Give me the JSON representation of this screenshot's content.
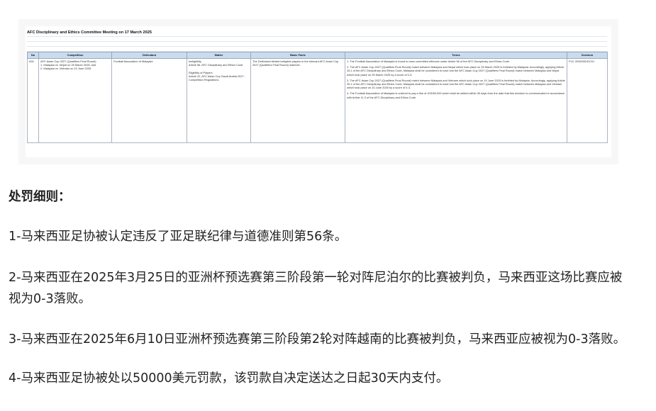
{
  "sheet": {
    "title": "AFC Disciplinary and Ethics Committee Meeting on 17 March 2025",
    "headers": [
      "No",
      "Competition",
      "Defendant",
      "Matter",
      "Basic Facts",
      "Terms",
      "Decision"
    ],
    "row": {
      "no": "A01",
      "competition": "AFC Asian Cup 2027 (Qualifiers Final Round)\n1. Malaysia vs. Nepal on 25 March 2025; and\n2. Malaysia vs. Vietnam on 10 June 2025.",
      "defendant": "Football Association of Malaysia",
      "matter": "Ineligibility\nArticle 56, AFC Disciplinary and Ethics Code\n\nEligibility of Players\nArticle 22, AFC Asian Cup Saudi Arabia 2027 - Competition Regulations",
      "basic_facts": "The Defendant fielded ineligible players in the relevant AFC Asian Cup 2027 (Qualifiers Final Round) matches.",
      "terms": [
        "1. The Football Association of Malaysia is found to have committed offences under Article 56 of the AFC Disciplinary and Ethics Code.",
        "2. The AFC Asian Cup 2027 (Qualifiers Final Round) match between Malaysia and Nepal which took place on 25 March 2025 is forfeited by Malaysia. Accordingly, applying Article 25.1 of the AFC Disciplinary and Ethics Code, Malaysia shall be considered to have lost the AFC Asian Cup 2027 (Qualifiers Final Round) match between Malaysia and Nepal which took place on 25 March 2025 by a score of 0-3.",
        "3. The AFC Asian Cup 2027 (Qualifiers Final Round) match between Malaysia and Vietnam which took place on 10 June 2025 is forfeited by Malaysia. Accordingly, applying Article 25.1 of the AFC Disciplinary and Ethics Code, Malaysia shall be considered to have lost the AFC Asian Cup 2027 (Qualifiers Final Round) match between Malaysia and Vietnam which took place on 10 June 2025 by a score of 0-3.",
        "4. The Football Association of Malaysia is ordered to pay a fine of USD50,000 which shall be settled within 30 days from the date that this decision is communicated in accordance with Article 11.3 of the AFC Disciplinary and Ethics Code."
      ],
      "decision": "FVC 2025/051/DC01"
    }
  },
  "article": {
    "heading": "处罚细则：",
    "items": [
      "1-马来西亚足协被认定违反了亚足联纪律与道德准则第56条。",
      "2-马来西亚在2025年3月25日的亚洲杯预选赛第三阶段第一轮对阵尼泊尔的比赛被判负，马来西亚这场比赛应被",
      "视为0-3落败。",
      "3-马来西亚在2025年6月10日亚洲杯预选赛第三阶段第2轮对阵越南的比赛被判负，马来西亚应被视为0-3落败。",
      "4-马来西亚足协被处以50000美元罚款，该罚款自决定送达之日起30天内支付。"
    ]
  }
}
